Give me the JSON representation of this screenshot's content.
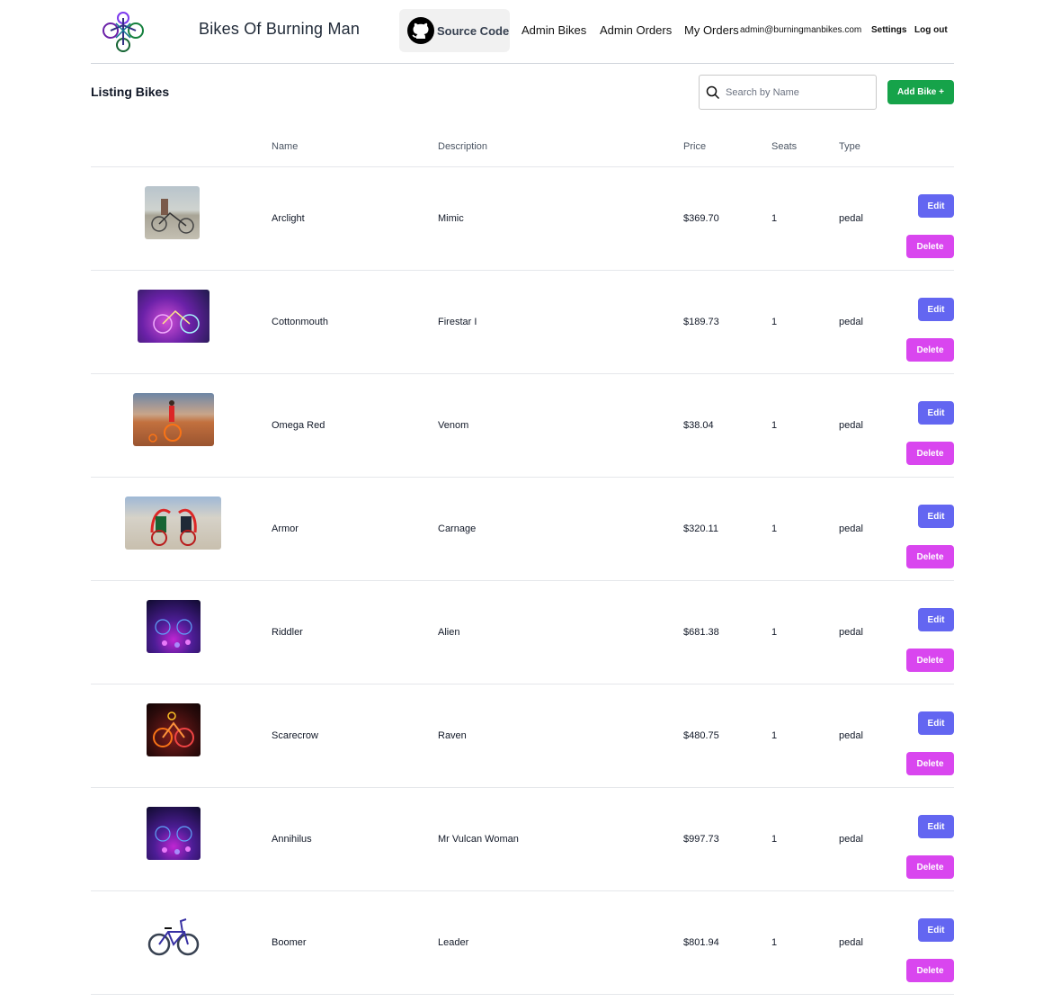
{
  "header": {
    "site_title": "Bikes Of Burning Man",
    "source_code_label": "Source Code",
    "nav": [
      "Admin Bikes",
      "Admin Orders",
      "My Orders"
    ],
    "user_email": "admin@burningmanbikes.com",
    "settings_label": "Settings",
    "logout_label": "Log out"
  },
  "listing": {
    "title": "Listing Bikes",
    "search_placeholder": "Search by Name",
    "add_button": "Add Bike +"
  },
  "table": {
    "columns": [
      "Name",
      "Description",
      "Price",
      "Seats",
      "Type"
    ],
    "edit_label": "Edit",
    "delete_label": "Delete",
    "rows": [
      {
        "name": "Arclight",
        "description": "Mimic",
        "price": "$369.70",
        "seats": "1",
        "type": "pedal",
        "image": "rider-on-desert-photo"
      },
      {
        "name": "Cottonmouth",
        "description": "Firestar I",
        "price": "$189.73",
        "seats": "1",
        "type": "pedal",
        "image": "neon-bike-night-photo"
      },
      {
        "name": "Omega Red",
        "description": "Venom",
        "price": "$38.04",
        "seats": "1",
        "type": "pedal",
        "image": "tall-bike-desert-photo"
      },
      {
        "name": "Armor",
        "description": "Carnage",
        "price": "$320.11",
        "seats": "1",
        "type": "pedal",
        "image": "octopus-art-car-photo"
      },
      {
        "name": "Riddler",
        "description": "Alien",
        "price": "$681.38",
        "seats": "1",
        "type": "pedal",
        "image": "led-bike-night-photo"
      },
      {
        "name": "Scarecrow",
        "description": "Raven",
        "price": "$480.75",
        "seats": "1",
        "type": "pedal",
        "image": "red-el-wire-bike-photo"
      },
      {
        "name": "Annihilus",
        "description": "Mr Vulcan Woman",
        "price": "$997.73",
        "seats": "1",
        "type": "pedal",
        "image": "led-bike-night-photo"
      },
      {
        "name": "Boomer",
        "description": "Leader",
        "price": "$801.94",
        "seats": "1",
        "type": "pedal",
        "image": "blue-cruiser-bike-photo"
      }
    ]
  },
  "colors": {
    "add_button": "#16a34a",
    "edit_button": "#6366f1",
    "delete_button": "#d946ef"
  }
}
